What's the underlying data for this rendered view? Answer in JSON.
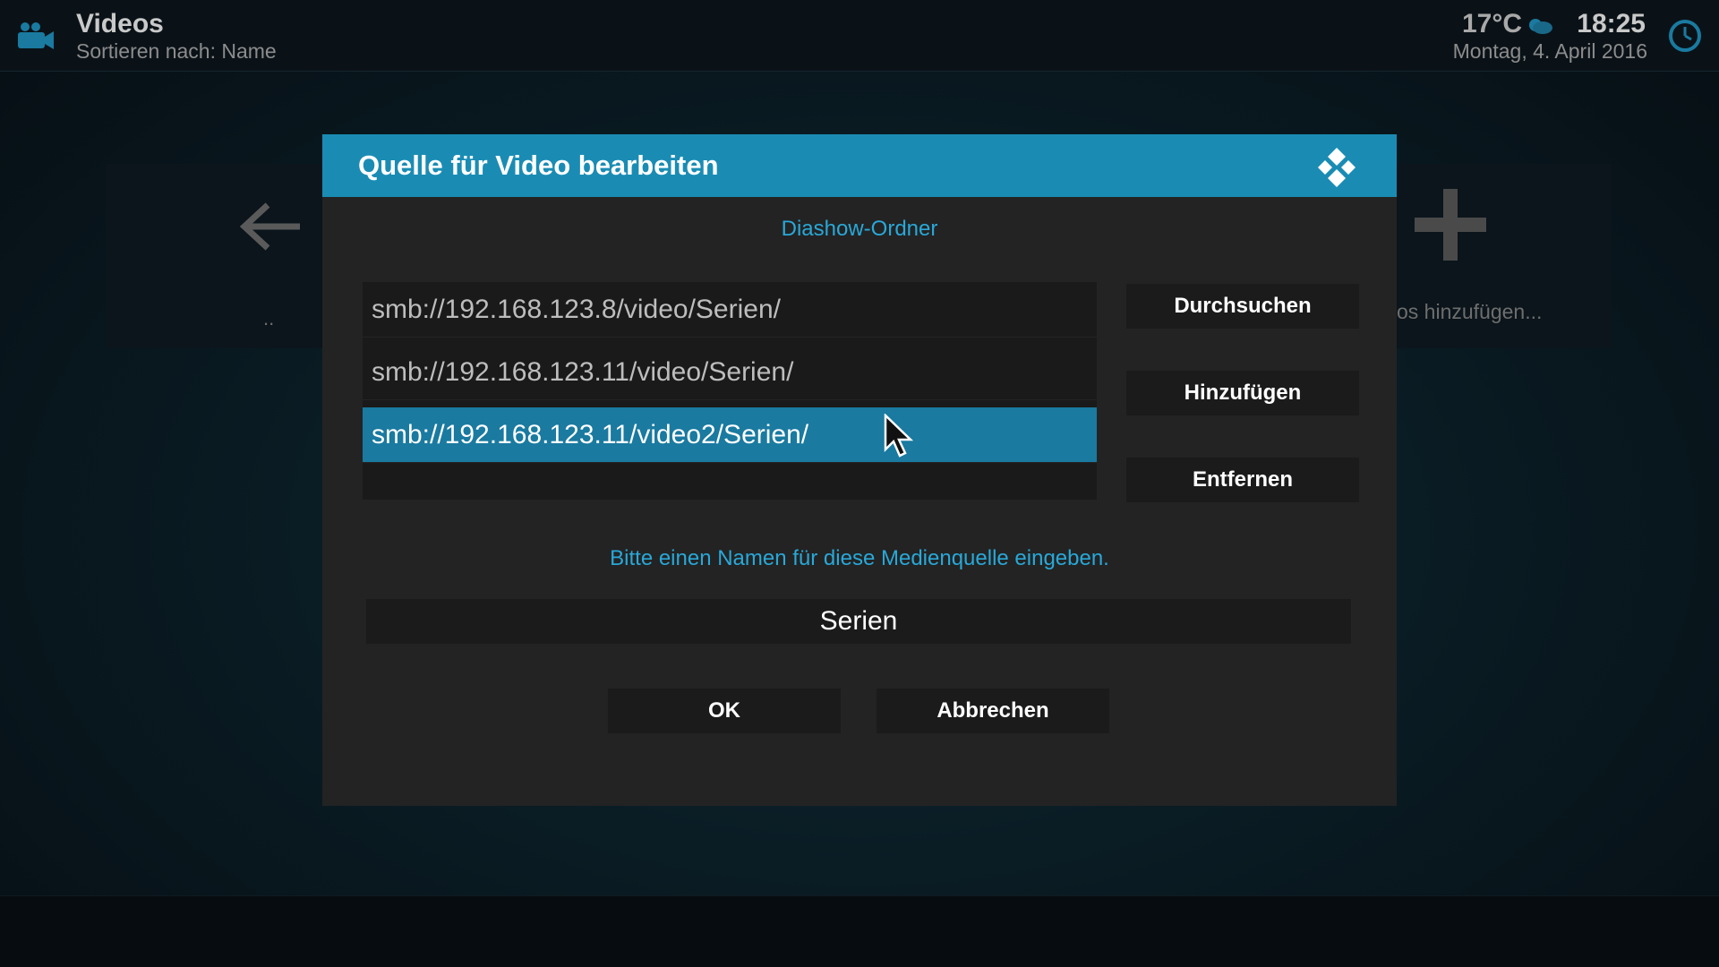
{
  "topbar": {
    "title": "Videos",
    "subtitle": "Sortieren nach: Name",
    "temperature": "17°C",
    "time": "18:25",
    "date": "Montag, 4. April 2016",
    "icons": [
      "video-camera-icon",
      "weather-cloud-icon",
      "clock-icon"
    ]
  },
  "background": {
    "left_tile_label": "..",
    "right_tile_label": "os hinzufügen..."
  },
  "dialog": {
    "title": "Quelle für Video bearbeiten",
    "heading": "Diashow-Ordner",
    "paths": [
      "smb://192.168.123.8/video/Serien/",
      "smb://192.168.123.11/video/Serien/",
      "smb://192.168.123.11/video2/Serien/"
    ],
    "selected_path_index": 2,
    "buttons": {
      "browse": "Durchsuchen",
      "add": "Hinzufügen",
      "remove": "Entfernen",
      "ok": "OK",
      "cancel": "Abbrechen"
    },
    "name_prompt": "Bitte einen Namen für diese Medienquelle eingeben.",
    "name_value": "Serien"
  },
  "colors": {
    "accent": "#1a8cb4",
    "selection": "#1a7aa0",
    "highlight_text": "#29a8d8"
  }
}
